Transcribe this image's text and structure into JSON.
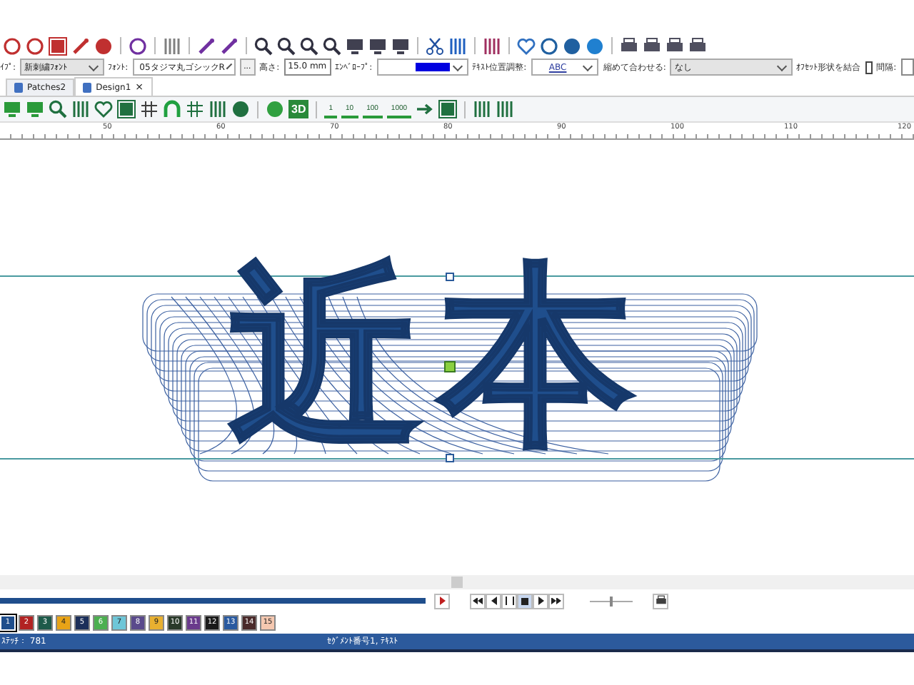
{
  "properties": {
    "style_label": "ｲﾌﾟ:",
    "style_value": "新刺繍ﾌｫﾝﾄ",
    "font_label": "ﾌｫﾝﾄ:",
    "font_value": "05タジマ丸ゴシックR",
    "font_more": "...",
    "height_label": "高さ:",
    "height_value": "15.0 mm",
    "envelope_label": "ｴﾝﾍﾞﾛｰﾌﾟ:",
    "text_align_label": "ﾃｷｽﾄ位置調整:",
    "text_align_value": "ABC",
    "fit_label": "縮めて合わせる:",
    "fit_value": "なし",
    "merge_label": "ｵﾌｾｯﾄ形状を結合",
    "merge_checked": false,
    "spacing_label": "間隔:"
  },
  "tabs": [
    {
      "label": "Patches2",
      "selected": false
    },
    {
      "label": "Design1",
      "selected": true,
      "close": "×"
    }
  ],
  "toolbar2_labels": {
    "view3d": "3D",
    "steps": [
      "1",
      "10",
      "100",
      "1000"
    ]
  },
  "ruler": {
    "ticks": [
      "50",
      "60",
      "70",
      "80",
      "90",
      "100",
      "110",
      "120"
    ]
  },
  "canvas": {
    "design_text": "近本"
  },
  "playback": {
    "progress": {
      "level": 1
    },
    "speed": {
      "level": 0.5
    }
  },
  "palette": [
    {
      "label": "1",
      "color": "#1f4e8c",
      "selected": true
    },
    {
      "label": "2",
      "color": "#b22222",
      "selected": false
    },
    {
      "label": "3",
      "color": "#1e5a4a",
      "selected": false
    },
    {
      "label": "4",
      "color": "#e8a317",
      "selected": false
    },
    {
      "label": "5",
      "color": "#1c2f5a",
      "selected": false
    },
    {
      "label": "6",
      "color": "#4caf50",
      "selected": false
    },
    {
      "label": "7",
      "color": "#6ec6d8",
      "selected": false
    },
    {
      "label": "8",
      "color": "#5a4a8c",
      "selected": false
    },
    {
      "label": "9",
      "color": "#e8b030",
      "selected": false
    },
    {
      "label": "10",
      "color": "#2a3a2a",
      "selected": false
    },
    {
      "label": "11",
      "color": "#6a3a8c",
      "selected": false
    },
    {
      "label": "12",
      "color": "#1a1a1a",
      "selected": false
    },
    {
      "label": "13",
      "color": "#2a5aa0",
      "selected": false
    },
    {
      "label": "14",
      "color": "#4a2a2a",
      "selected": false
    },
    {
      "label": "15",
      "color": "#f5c8b0",
      "selected": false
    }
  ],
  "status_bar": {
    "stitches": "ｽﾃｯﾁ： 781",
    "segment": "ｾｸﾞﾒﾝﾄ番号1, ﾃｷｽﾄ"
  }
}
